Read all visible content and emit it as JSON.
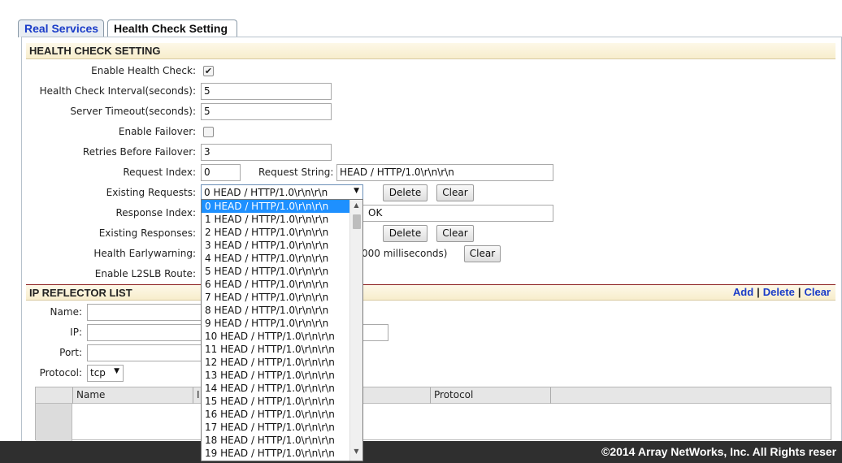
{
  "tabs": [
    {
      "label": "Real Services"
    },
    {
      "label": "Health Check Setting"
    }
  ],
  "health": {
    "section_title": "HEALTH CHECK SETTING",
    "enable_label": "Enable Health Check:",
    "enable_checked": "✔",
    "interval_label": "Health Check Interval(seconds):",
    "interval_value": "5",
    "timeout_label": "Server Timeout(seconds):",
    "timeout_value": "5",
    "failover_label": "Enable Failover:",
    "retries_label": "Retries Before Failover:",
    "retries_value": "3",
    "request_index_label": "Request Index:",
    "request_index_value": "0",
    "request_string_label": "Request String:",
    "request_string_value": "HEAD / HTTP/1.0\\r\\n\\r\\n",
    "existing_requests_label": "Existing Requests:",
    "existing_requests_selected": "0 HEAD / HTTP/1.0\\r\\n\\r\\n",
    "response_index_label": "Response Index:",
    "response_string_partial": "OK",
    "existing_responses_label": "Existing Responses:",
    "earlywarning_label": "Health Earlywarning:",
    "earlywarning_suffix": "000 milliseconds)",
    "l2slb_label": "Enable L2SLB Route:",
    "delete_label": "Delete",
    "clear_label": "Clear"
  },
  "reflector": {
    "section_title": "IP REFLECTOR LIST",
    "add_link": "Add",
    "delete_link": "Delete",
    "clear_link": "Clear",
    "separator": "|",
    "name_label": "Name:",
    "ip_label": "IP:",
    "port_label": "Port:",
    "protocol_label": "Protocol:",
    "protocol_value": "tcp",
    "columns": [
      "Name",
      "I",
      "Protocol"
    ]
  },
  "dropdown_options": [
    "0 HEAD / HTTP/1.0\\r\\n\\r\\n",
    "1 HEAD / HTTP/1.0\\r\\n\\r\\n",
    "2 HEAD / HTTP/1.0\\r\\n\\r\\n",
    "3 HEAD / HTTP/1.0\\r\\n\\r\\n",
    "4 HEAD / HTTP/1.0\\r\\n\\r\\n",
    "5 HEAD / HTTP/1.0\\r\\n\\r\\n",
    "6 HEAD / HTTP/1.0\\r\\n\\r\\n",
    "7 HEAD / HTTP/1.0\\r\\n\\r\\n",
    "8 HEAD / HTTP/1.0\\r\\n\\r\\n",
    "9 HEAD / HTTP/1.0\\r\\n\\r\\n",
    "10 HEAD / HTTP/1.0\\r\\n\\r\\n",
    "11 HEAD / HTTP/1.0\\r\\n\\r\\n",
    "12 HEAD / HTTP/1.0\\r\\n\\r\\n",
    "13 HEAD / HTTP/1.0\\r\\n\\r\\n",
    "14 HEAD / HTTP/1.0\\r\\n\\r\\n",
    "15 HEAD / HTTP/1.0\\r\\n\\r\\n",
    "16 HEAD / HTTP/1.0\\r\\n\\r\\n",
    "17 HEAD / HTTP/1.0\\r\\n\\r\\n",
    "18 HEAD / HTTP/1.0\\r\\n\\r\\n",
    "19 HEAD / HTTP/1.0\\r\\n\\r\\n"
  ],
  "footer": {
    "copyright": "©2014 Array NetWorks, Inc. All Rights reser"
  }
}
